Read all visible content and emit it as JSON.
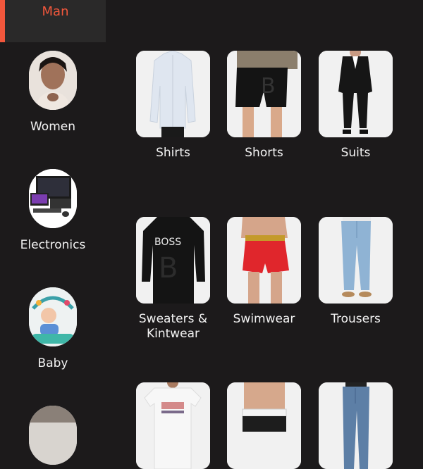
{
  "sidebar": {
    "active": {
      "label": "Man"
    },
    "items": [
      {
        "label": "Women",
        "icon": "woman-portrait-image"
      },
      {
        "label": "Electronics",
        "icon": "electronics-image"
      },
      {
        "label": "Baby",
        "icon": "baby-image"
      },
      {
        "label": "",
        "icon": "category-image"
      }
    ]
  },
  "grid": {
    "items": [
      {
        "label": "Shirts",
        "icon": "shirt-image"
      },
      {
        "label": "Shorts",
        "icon": "shorts-image"
      },
      {
        "label": "Suits",
        "icon": "suit-image"
      },
      {
        "label": "Sweaters & Kintwear",
        "icon": "sweater-image"
      },
      {
        "label": "Swimwear",
        "icon": "swimwear-image"
      },
      {
        "label": "Trousers",
        "icon": "trousers-image"
      },
      {
        "label": "",
        "icon": "tshirt-image"
      },
      {
        "label": "",
        "icon": "underwear-image"
      },
      {
        "label": "",
        "icon": "jeans-image"
      }
    ]
  },
  "colors": {
    "background": "#1c1a1b",
    "accent": "#f2573c",
    "active_bg": "#2a2929"
  }
}
